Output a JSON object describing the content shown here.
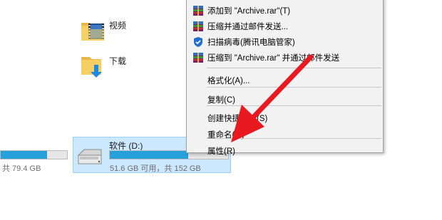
{
  "folders": [
    {
      "label": "视频",
      "icon": "video-folder-icon"
    },
    {
      "label": "下载",
      "icon": "download-folder-icon"
    }
  ],
  "drives": {
    "c": {
      "size_text": "共 79.4 GB",
      "used_fraction": 0.7
    },
    "d": {
      "name": "软件 (D:)",
      "size_text": "51.6 GB 可用，共 152 GB",
      "used_fraction": 0.66
    }
  },
  "context_menu": {
    "items": [
      {
        "label": "添加到 \"Archive.rar\"(T)",
        "icon": "winrar-icon"
      },
      {
        "label": "压缩并通过邮件发送...",
        "icon": "winrar-icon"
      },
      {
        "label": "扫描病毒(腾讯电脑管家)",
        "icon": "tencent-shield-icon"
      },
      {
        "label": "压缩到 \"Archive.rar\" 并通过邮件发送",
        "icon": "winrar-icon"
      },
      {
        "label": "格式化(A)..."
      },
      {
        "label": "复制(C)"
      },
      {
        "label": "创建快捷方式(S)"
      },
      {
        "label": "重命名(M)"
      },
      {
        "label": "属性(R)"
      }
    ]
  },
  "colors": {
    "selection_bg": "#cce8ff",
    "selection_border": "#99d1ff",
    "bar_fill": "#26a0da",
    "annotation_arrow": "#e8191f"
  }
}
